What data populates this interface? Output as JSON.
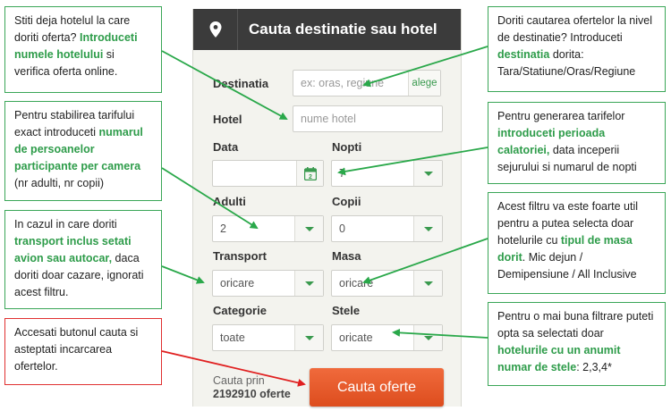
{
  "panel": {
    "title": "Cauta destinatie sau hotel",
    "destination": {
      "label": "Destinatia",
      "placeholder": "ex: oras, regiune",
      "button": "alege"
    },
    "hotel": {
      "label": "Hotel",
      "placeholder": "nume hotel"
    },
    "date": {
      "label": "Data",
      "value": ""
    },
    "nights": {
      "label": "Nopti",
      "value": "7"
    },
    "adults": {
      "label": "Adulti",
      "value": "2"
    },
    "children": {
      "label": "Copii",
      "value": "0"
    },
    "transport": {
      "label": "Transport",
      "value": "oricare"
    },
    "meal": {
      "label": "Masa",
      "value": "oricare"
    },
    "category": {
      "label": "Categorie",
      "value": "toate"
    },
    "stars": {
      "label": "Stele",
      "value": "oricate"
    },
    "footer": {
      "prefix": "Cauta prin",
      "count": "2192910 oferte"
    },
    "search_button": "Cauta oferte"
  },
  "callouts": {
    "hotel_name": {
      "t1": "Stiti deja hotelul la care doriti oferta? ",
      "h1": "Introduceti numele hotelului",
      "t2": " si verifica oferta online."
    },
    "persons": {
      "t1": "Pentru stabilirea tarifului exact introduceti ",
      "h1": "numarul de persoanelor participante per camera",
      "t2": " (nr adulti, nr copii)"
    },
    "transport": {
      "t1": "In cazul in care doriti ",
      "h1": "transport inclus setati avion sau autocar,",
      "t2": " daca doriti doar cazare, ignorati acest filtru."
    },
    "search": {
      "t1": "Accesati butonul cauta si asteptati incarcarea ofertelor."
    },
    "destination": {
      "t1": "Doriti cautarea ofertelor la nivel de destinatie? Introduceti ",
      "h1": "destinatia",
      "t2": " dorita: Tara/Statiune/Oras/Regiune"
    },
    "period": {
      "t1": "Pentru generarea tarifelor ",
      "h1": "introduceti perioada calatoriei,",
      "t2": " data inceperii sejurului si numarul de nopti"
    },
    "meal": {
      "t1": "Acest filtru va este foarte util pentru a putea selecta doar hotelurile cu ",
      "h1": "tipul de masa dorit",
      "t2": ". Mic dejun / Demipensiune / All Inclusive"
    },
    "stars": {
      "t1": "Pentru o mai buna filtrare puteti opta sa selectati doar ",
      "h1": "hotelurile cu un anumit numar de stele",
      "t2": ": 2,3,4*"
    }
  },
  "colors": {
    "accent": "#2e9c4a",
    "search_button": "#e85a2a",
    "header": "#3b3b3b",
    "callout_border": "#3aa657",
    "callout_red": "#e03030"
  }
}
